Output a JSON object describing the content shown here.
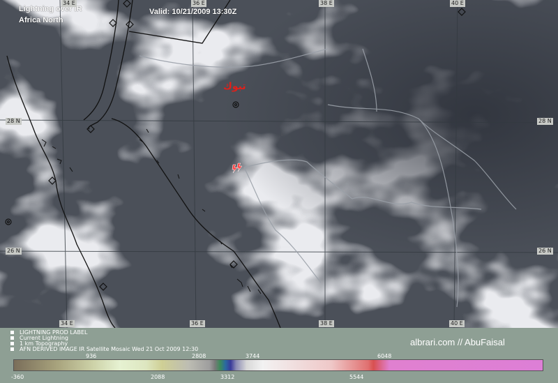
{
  "title": {
    "line1": "Lightning over IR",
    "line2": "Africa North"
  },
  "valid": "Valid: 10/21/2009 13:30Z",
  "lon_labels": [
    "34 E",
    "36 E",
    "38 E",
    "40 E"
  ],
  "lat_labels": [
    "28 N",
    "26 N"
  ],
  "city_label": "تبوك",
  "legend": [
    "LIGHTNING PROD LABEL",
    "Current Lightning",
    "1 km Topography",
    "AFN DERIVED IMAGE IR Satellite Mosaic Wed 21 Oct 2009 12:30"
  ],
  "brand": "albrari.com // AbuFaisal",
  "colorbar": {
    "upper_ticks": [
      "936",
      "2808",
      "3744",
      "6048"
    ],
    "lower_ticks": [
      "-360",
      "2088",
      "3312",
      "5544"
    ]
  }
}
